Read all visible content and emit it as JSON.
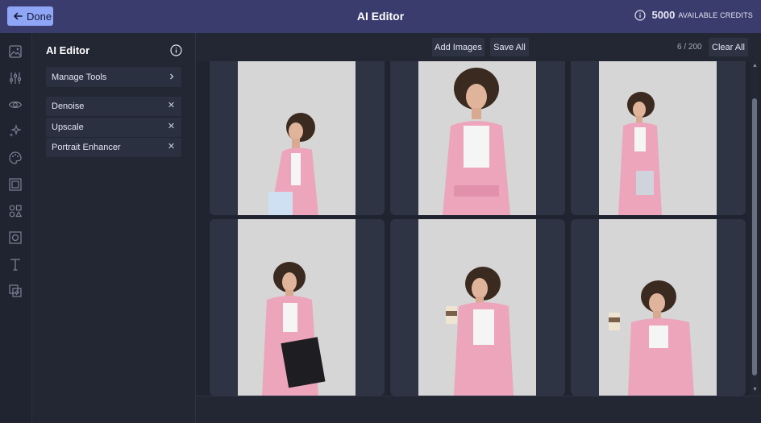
{
  "header": {
    "done_label": "Done",
    "title": "AI Editor",
    "credits_value": "5000",
    "credits_label": "AVAILABLE CREDITS"
  },
  "rail": {
    "icons": [
      "image-icon",
      "sliders-icon",
      "eye-icon",
      "sparkle-icon",
      "palette-icon",
      "frame-icon",
      "shapes-icon",
      "border-icon",
      "text-icon",
      "layers-icon"
    ]
  },
  "panel": {
    "title": "AI Editor",
    "manage_label": "Manage Tools",
    "tools": [
      {
        "label": "Denoise"
      },
      {
        "label": "Upscale"
      },
      {
        "label": "Portrait Enhancer"
      }
    ]
  },
  "toolbar": {
    "add_images_label": "Add Images",
    "save_all_label": "Save All",
    "count": "6 / 200",
    "clear_all_label": "Clear All"
  },
  "colors": {
    "header_bg": "#3b3c6e",
    "accent": "#8fa5f5",
    "suit_pink": "#eda5bc",
    "photo_bg": "#d6d6d6"
  }
}
